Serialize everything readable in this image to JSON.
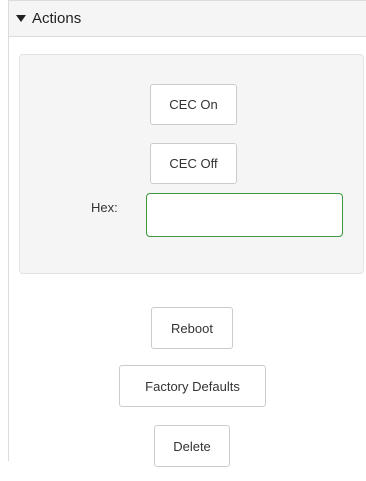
{
  "actions_panel": {
    "title": "Actions",
    "cec": {
      "on_label": "CEC On",
      "off_label": "CEC Off",
      "hex_label": "Hex:",
      "hex_value": "",
      "hex_placeholder": ""
    },
    "buttons": {
      "reboot_label": "Reboot",
      "factory_defaults_label": "Factory Defaults",
      "delete_label": "Delete"
    },
    "colors": {
      "input_focus_border": "#3c9a3c",
      "header_background": "#f5f5f5",
      "well_background": "#f5f5f5"
    }
  }
}
